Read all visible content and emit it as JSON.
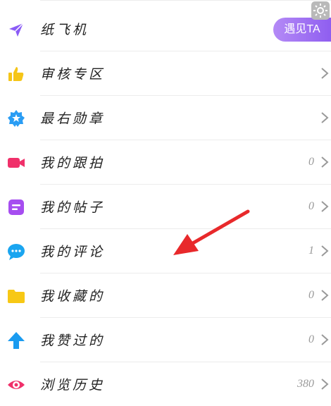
{
  "menu": {
    "items": [
      {
        "label": "纸飞机",
        "icon": "paper-plane-icon",
        "color": "#8b5cf6",
        "action_label": "遇见TA"
      },
      {
        "label": "审核专区",
        "icon": "thumbs-up-icon",
        "color": "#f5c518"
      },
      {
        "label": "最右勋章",
        "icon": "medal-star-icon",
        "color": "#2a9df4"
      },
      {
        "label": "我的跟拍",
        "icon": "video-camera-icon",
        "color": "#f0306a",
        "count": "0"
      },
      {
        "label": "我的帖子",
        "icon": "post-icon",
        "color": "#a64df0",
        "count": "0"
      },
      {
        "label": "我的评论",
        "icon": "comment-bubble-icon",
        "color": "#1aa5f0",
        "count": "1"
      },
      {
        "label": "我收藏的",
        "icon": "folder-icon",
        "color": "#f7c815",
        "count": "0"
      },
      {
        "label": "我赞过的",
        "icon": "up-arrow-icon",
        "color": "#1a9bf0",
        "count": "0"
      },
      {
        "label": "浏览历史",
        "icon": "eye-icon",
        "color": "#f0306a",
        "count": "380"
      }
    ]
  },
  "colors": {
    "accent": "#8f5ef0",
    "annotation_arrow": "#e8292b"
  }
}
